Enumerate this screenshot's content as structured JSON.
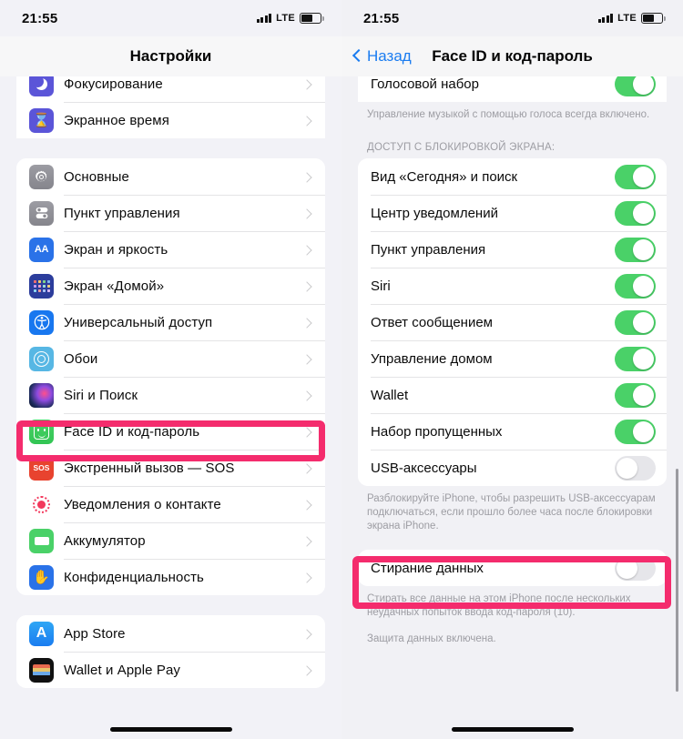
{
  "status_bar": {
    "time": "21:55",
    "network": "LTE",
    "signal_icon": "signal-bars-icon",
    "battery_icon": "battery-icon"
  },
  "left_screen": {
    "nav_title": "Настройки",
    "group_top": {
      "items": [
        {
          "label": "Фокусирование",
          "icon": "moon-icon"
        },
        {
          "label": "Экранное время",
          "icon": "hourglass-icon"
        }
      ]
    },
    "group_main": {
      "items": [
        {
          "label": "Основные",
          "icon": "gear-icon"
        },
        {
          "label": "Пункт управления",
          "icon": "sliders-icon"
        },
        {
          "label": "Экран и яркость",
          "icon": "aa-text-icon"
        },
        {
          "label": "Экран «Домой»",
          "icon": "app-grid-icon"
        },
        {
          "label": "Универсальный доступ",
          "icon": "accessibility-icon"
        },
        {
          "label": "Обои",
          "icon": "wallpaper-flower-icon"
        },
        {
          "label": "Siri и Поиск",
          "icon": "siri-orb-icon"
        },
        {
          "label": "Face ID и код-пароль",
          "icon": "face-id-icon",
          "highlighted": true
        },
        {
          "label": "Экстренный вызов — SOS",
          "icon": "sos-icon"
        },
        {
          "label": "Уведомления о контакте",
          "icon": "contact-alert-icon"
        },
        {
          "label": "Аккумулятор",
          "icon": "battery-green-icon"
        },
        {
          "label": "Конфиденциальность",
          "icon": "hand-privacy-icon"
        }
      ]
    },
    "group_store": {
      "items": [
        {
          "label": "App Store",
          "icon": "app-store-icon"
        },
        {
          "label": "Wallet и Apple Pay",
          "icon": "wallet-icon"
        }
      ]
    }
  },
  "right_screen": {
    "back_label": "Назад",
    "nav_title": "Face ID и код-пароль",
    "top_partial_row": {
      "label": "Голосовой набор",
      "toggle": "on"
    },
    "top_footnote": "Управление музыкой с помощью голоса всегда включено.",
    "section_header": "ДОСТУП С БЛОКИРОВКОЙ ЭКРАНА:",
    "lock_screen_items": [
      {
        "label": "Вид «Сегодня» и поиск",
        "toggle": "on"
      },
      {
        "label": "Центр уведомлений",
        "toggle": "on"
      },
      {
        "label": "Пункт управления",
        "toggle": "on"
      },
      {
        "label": "Siri",
        "toggle": "on"
      },
      {
        "label": "Ответ сообщением",
        "toggle": "on"
      },
      {
        "label": "Управление домом",
        "toggle": "on"
      },
      {
        "label": "Wallet",
        "toggle": "on"
      },
      {
        "label": "Набор пропущенных",
        "toggle": "on"
      },
      {
        "label": "USB-аксессуары",
        "toggle": "off"
      }
    ],
    "usb_footnote": "Разблокируйте iPhone, чтобы разрешить USB-аксессуарам подключаться, если прошло более часа после блокировки экрана iPhone.",
    "erase_row": {
      "label": "Стирание данных",
      "toggle": "off",
      "highlighted": true
    },
    "erase_footnote": "Стирать все данные на этом iPhone после нескольких неудачных попыток ввода код-пароля (10).",
    "protection_note": "Защита данных включена."
  },
  "colors": {
    "highlight": "#f42c6d",
    "toggle_on": "#4ad168",
    "toggle_off": "#e6e6ea",
    "accent_blue": "#1a7cf0",
    "background": "#f2f2f7"
  }
}
